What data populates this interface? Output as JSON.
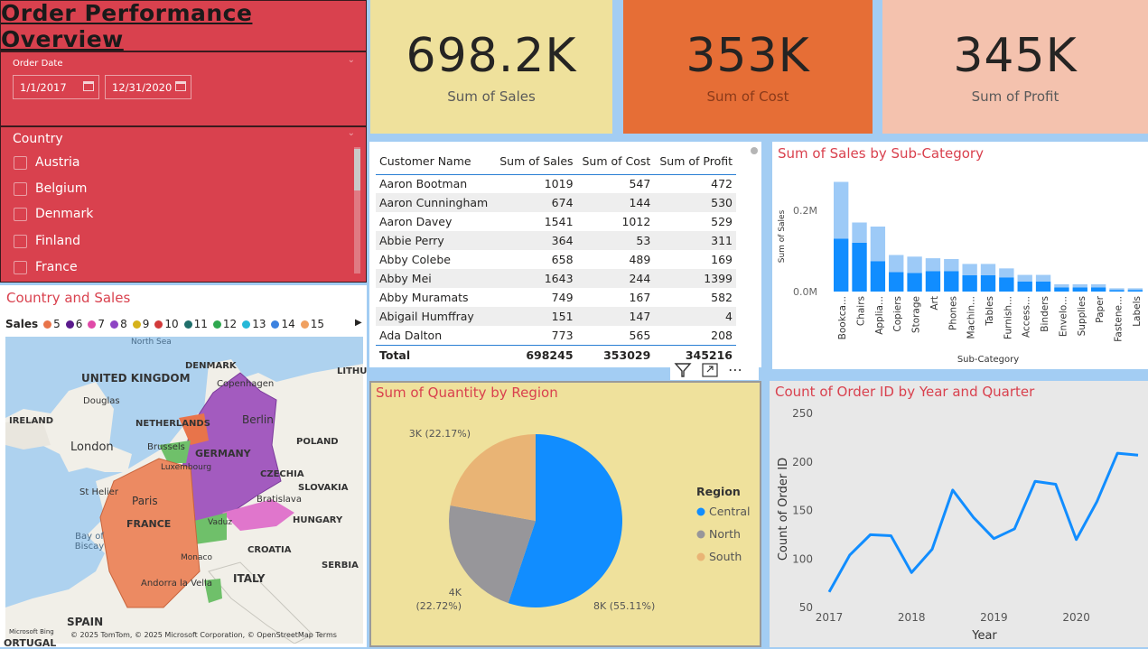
{
  "title": "Order Performance Overview",
  "date_slicer": {
    "label": "Order Date",
    "start": "1/1/2017",
    "end": "12/31/2020"
  },
  "country_slicer": {
    "label": "Country",
    "items": [
      "Austria",
      "Belgium",
      "Denmark",
      "Finland",
      "France"
    ]
  },
  "kpis": [
    {
      "value": "698.2K",
      "label": "Sum of Sales",
      "color": "#efe19c"
    },
    {
      "value": "353K",
      "label": "Sum of Cost",
      "color": "#e66e36"
    },
    {
      "value": "345K",
      "label": "Sum of Profit",
      "color": "#f4c2ae"
    }
  ],
  "table": {
    "headers": [
      "Customer Name",
      "Sum of Sales",
      "Sum of Cost",
      "Sum of Profit"
    ],
    "rows": [
      [
        "Aaron Bootman",
        "1019",
        "547",
        "472"
      ],
      [
        "Aaron Cunningham",
        "674",
        "144",
        "530"
      ],
      [
        "Aaron Davey",
        "1541",
        "1012",
        "529"
      ],
      [
        "Abbie Perry",
        "364",
        "53",
        "311"
      ],
      [
        "Abby Colebe",
        "658",
        "489",
        "169"
      ],
      [
        "Abby Mei",
        "1643",
        "244",
        "1399"
      ],
      [
        "Abby Muramats",
        "749",
        "167",
        "582"
      ],
      [
        "Abigail Humffray",
        "151",
        "147",
        "4"
      ],
      [
        "Ada Dalton",
        "773",
        "565",
        "208"
      ]
    ],
    "total": [
      "Total",
      "698245",
      "353029",
      "345216"
    ]
  },
  "map": {
    "title": "Country and Sales",
    "legend_label": "Sales",
    "legend": [
      {
        "label": "5",
        "color": "#e8744a"
      },
      {
        "label": "6",
        "color": "#5a1a8c"
      },
      {
        "label": "7",
        "color": "#e04aa8"
      },
      {
        "label": "8",
        "color": "#8e44c4"
      },
      {
        "label": "9",
        "color": "#d6b21a"
      },
      {
        "label": "10",
        "color": "#d23a3a"
      },
      {
        "label": "11",
        "color": "#1f6e6a"
      },
      {
        "label": "12",
        "color": "#2fa84f"
      },
      {
        "label": "13",
        "color": "#26b8d8"
      },
      {
        "label": "14",
        "color": "#3b82e0"
      },
      {
        "label": "15",
        "color": "#f0a060"
      }
    ],
    "labels": [
      "North Sea",
      "UNITED KINGDOM",
      "Douglas",
      "IRELAND",
      "London",
      "DENMARK",
      "Copenhagen",
      "NETHERLANDS",
      "Berlin",
      "POLAND",
      "Brussels",
      "GERMANY",
      "Luxembourg",
      "CZECHIA",
      "St Helier",
      "Paris",
      "SLOVAKIA",
      "Bratislava",
      "FRANCE",
      "HUNGARY",
      "Bay of Biscay",
      "Vaduz",
      "CROATIA",
      "Monaco",
      "SERBIA",
      "ITALY",
      "Andorra la Vella",
      "SPAIN",
      "ORTUGAL",
      "LITHU"
    ],
    "attribution": "© 2025 TomTom, © 2025 Microsoft Corporation, © OpenStreetMap  Terms",
    "bing": "Microsoft Bing"
  },
  "chart_data": [
    {
      "type": "bar",
      "title": "Sum of Sales by Sub-Category",
      "xlabel": "Sub-Category",
      "ylabel": "Sum of Sales",
      "categories": [
        "Bookca...",
        "Chairs",
        "Applia...",
        "Copiers",
        "Storage",
        "Art",
        "Phones",
        "Machin...",
        "Tables",
        "Furnish...",
        "Access...",
        "Binders",
        "Envelo...",
        "Supplies",
        "Paper",
        "Fastene...",
        "Labels"
      ],
      "series": [
        {
          "values": [
            0.13,
            0.12,
            0.075,
            0.048,
            0.046,
            0.05,
            0.05,
            0.04,
            0.04,
            0.035,
            0.025,
            0.025,
            0.01,
            0.01,
            0.01,
            0.004,
            0.004
          ],
          "color": "#118dff"
        },
        {
          "values": [
            0.14,
            0.05,
            0.085,
            0.042,
            0.04,
            0.032,
            0.03,
            0.028,
            0.028,
            0.022,
            0.016,
            0.016,
            0.008,
            0.008,
            0.008,
            0.004,
            0.004
          ],
          "color": "#9dcaf7"
        }
      ],
      "yticks": [
        "0.0M",
        "0.2M"
      ],
      "ylim": [
        0,
        0.28
      ]
    },
    {
      "type": "pie",
      "title": "Sum of Quantity by Region",
      "legend_title": "Region",
      "slices": [
        {
          "name": "Central",
          "value": 55.11,
          "label": "8K (55.11%)",
          "color": "#118dff"
        },
        {
          "name": "North",
          "value": 22.72,
          "label": "4K (22.72%)",
          "color": "#97969a"
        },
        {
          "name": "South",
          "value": 22.17,
          "label": "3K (22.17%)",
          "color": "#e9b475"
        }
      ]
    },
    {
      "type": "line",
      "title": "Count of Order ID by Year and Quarter",
      "xlabel": "Year",
      "ylabel": "Count of Order ID",
      "x": [
        "2017 Q1",
        "2017 Q2",
        "2017 Q3",
        "2017 Q4",
        "2018 Q1",
        "2018 Q2",
        "2018 Q3",
        "2018 Q4",
        "2019 Q1",
        "2019 Q2",
        "2019 Q3",
        "2019 Q4",
        "2020 Q1",
        "2020 Q2",
        "2020 Q3",
        "2020 Q4"
      ],
      "values": [
        66,
        104,
        125,
        124,
        86,
        110,
        171,
        143,
        121,
        131,
        180,
        177,
        120,
        159,
        209,
        207
      ],
      "xticks": [
        "2017",
        "2018",
        "2019",
        "2020"
      ],
      "yticks": [
        50,
        100,
        150,
        200,
        250
      ],
      "ylim": [
        50,
        250
      ],
      "color": "#118dff"
    }
  ]
}
